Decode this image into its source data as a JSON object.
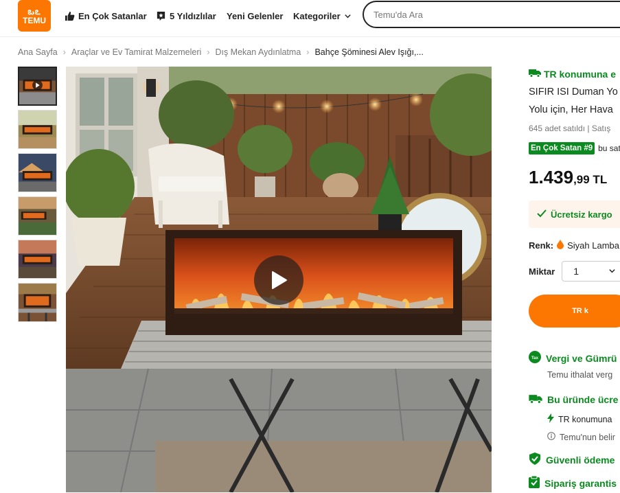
{
  "brand": {
    "logo_text": "TEMU",
    "logo_symbol": "ఒఽ"
  },
  "header": {
    "nav": [
      {
        "label": "En Çok Satanlar",
        "icon": "thumbs-up-icon"
      },
      {
        "label": "5 Yıldızlılar",
        "icon": "star-badge-icon"
      },
      {
        "label": "Yeni Gelenler",
        "icon": ""
      },
      {
        "label": "Kategoriler",
        "icon": "chevron-down-icon"
      }
    ],
    "search_placeholder": "Temu'da Ara"
  },
  "breadcrumb": {
    "items": [
      "Ana Sayfa",
      "Araçlar ve Ev Tamirat Malzemeleri",
      "Dış Mekan Aydınlatma",
      "Bahçe Şöminesi Alev Işığı,..."
    ],
    "separator": "›"
  },
  "gallery": {
    "thumb_count": 6,
    "active_index": 0
  },
  "product": {
    "shipping_line": "TR konumuna e",
    "title_line1": "SIFIR ISI Duman Yo",
    "title_line2": "Yolu için, Her Hava",
    "sold_text": "645 adet satıldı | Satış",
    "best_seller_badge": "En Çok Satan #9",
    "best_seller_suffix": "bu sat",
    "price_main": "1.439",
    "price_fraction": ",99 TL",
    "free_shipping": "Ücretsiz kargo",
    "color_label": "Renk:",
    "color_value": "Siyah Lamba",
    "quantity_label": "Miktar",
    "quantity_value": "1",
    "cart_button": "TR k",
    "tax_title": "Vergi ve Gümrü",
    "tax_sub": "Temu ithalat verg",
    "fast_title": "Bu üründe ücre",
    "fast_sub": "TR konumuna",
    "info_sub": "Temu'nun belir",
    "secure_pay": "Güvenli ödeme",
    "order_guarantee": "Sipariş garantis"
  },
  "colors": {
    "brand_orange": "#fb7701",
    "green": "#0a8a1f"
  }
}
